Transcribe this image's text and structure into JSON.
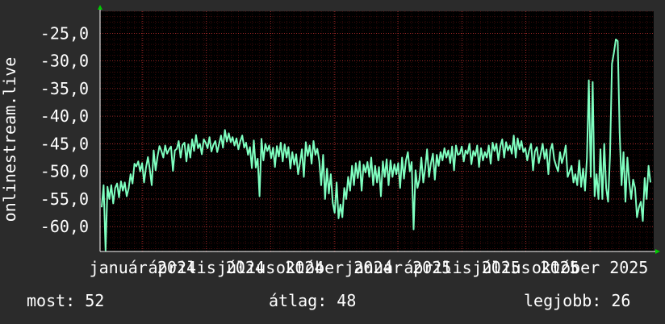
{
  "chart_data": {
    "type": "line",
    "ylabel": "onlinestream.live",
    "ylim": [
      -64.5,
      -21.0
    ],
    "yticks": [
      -25,
      -30,
      -35,
      -40,
      -45,
      -50,
      -55,
      -60
    ],
    "ytick_labels": [
      "-25,0",
      "-30,0",
      "-35,0",
      "-40,0",
      "-45,0",
      "-50,0",
      "-55,0",
      "-60,0"
    ],
    "xlim": [
      0,
      100
    ],
    "xticks": [
      {
        "x": 7.7,
        "label": "január 2024"
      },
      {
        "x": 19.2,
        "label": "április 2024"
      },
      {
        "x": 30.8,
        "label": "július 2024"
      },
      {
        "x": 42.3,
        "label": "október 2024"
      },
      {
        "x": 53.8,
        "label": "január 2025"
      },
      {
        "x": 65.4,
        "label": "április 2025"
      },
      {
        "x": 76.9,
        "label": "július 2025"
      },
      {
        "x": 88.5,
        "label": "október 2025"
      }
    ],
    "grid": true,
    "colors": {
      "background": "#2b2b2b",
      "plot_background": "#000000",
      "grid": "#8b1a1a",
      "axis": "#ffffff",
      "line": "#7fffc0",
      "arrow": "#00cc00"
    },
    "series": [
      {
        "values": [
          -56.5,
          -52.5,
          -64.3,
          -52.8,
          -55.0,
          -52.5,
          -55.8,
          -53.0,
          -52.2,
          -54.7,
          -51.8,
          -53.5,
          -52.0,
          -54.5,
          -53.1,
          -50.5,
          -52.2,
          -48.6,
          -49.1,
          -48.2,
          -50.0,
          -48.5,
          -52.0,
          -49.3,
          -47.4,
          -49.6,
          -52.5,
          -46.2,
          -49.8,
          -47.3,
          -45.4,
          -46.3,
          -47.5,
          -45.3,
          -46.8,
          -46.0,
          -45.5,
          -49.9,
          -46.2,
          -45.9,
          -44.5,
          -47.5,
          -45.2,
          -44.8,
          -48.2,
          -45.1,
          -47.5,
          -44.2,
          -46.3,
          -43.4,
          -45.8,
          -45.0,
          -46.9,
          -44.2,
          -44.8,
          -45.8,
          -43.8,
          -46.4,
          -45.2,
          -44.5,
          -46.5,
          -45.0,
          -43.5,
          -45.7,
          -42.5,
          -44.6,
          -43.1,
          -44.7,
          -43.8,
          -45.3,
          -44.0,
          -46.0,
          -44.5,
          -43.5,
          -45.7,
          -44.8,
          -47.0,
          -45.6,
          -49.4,
          -44.4,
          -49.3,
          -47.7,
          -54.5,
          -44.1,
          -48.0,
          -45.0,
          -46.3,
          -45.3,
          -47.6,
          -45.7,
          -49.2,
          -45.4,
          -47.3,
          -44.8,
          -48.2,
          -45.1,
          -47.5,
          -45.6,
          -49.5,
          -46.5,
          -48.8,
          -46.9,
          -50.5,
          -48.4,
          -46.0,
          -51.0,
          -44.7,
          -47.2,
          -45.3,
          -48.6,
          -44.5,
          -47.0,
          -45.9,
          -48.1,
          -52.5,
          -47.0,
          -55.0,
          -49.5,
          -54.0,
          -50.5,
          -55.7,
          -57.5,
          -52.0,
          -58.5,
          -56.0,
          -58.3,
          -53.0,
          -55.0,
          -51.0,
          -53.5,
          -49.0,
          -52.5,
          -48.5,
          -51.2,
          -48.2,
          -53.5,
          -48.8,
          -50.2,
          -48.3,
          -51.0,
          -47.5,
          -52.5,
          -49.0,
          -52.0,
          -49.2,
          -54.5,
          -48.2,
          -51.0,
          -47.8,
          -52.5,
          -48.0,
          -51.0,
          -48.7,
          -50.5,
          -48.5,
          -53.0,
          -47.5,
          -51.3,
          -48.0,
          -46.5,
          -50.0,
          -48.3,
          -60.5,
          -49.8,
          -53.0,
          -51.5,
          -47.5,
          -52.0,
          -49.5,
          -46.0,
          -51.0,
          -48.5,
          -46.8,
          -51.5,
          -47.0,
          -49.0,
          -46.5,
          -48.0,
          -45.8,
          -47.5,
          -46.2,
          -48.5,
          -45.5,
          -49.8,
          -45.3,
          -47.0,
          -46.8,
          -45.5,
          -48.2,
          -46.2,
          -46.8,
          -45.0,
          -48.7,
          -46.3,
          -47.2,
          -45.3,
          -49.2,
          -45.8,
          -48.0,
          -46.5,
          -47.5,
          -45.3,
          -48.6,
          -44.8,
          -46.3,
          -45.0,
          -48.0,
          -45.5,
          -44.2,
          -47.5,
          -44.7,
          -46.2,
          -45.3,
          -46.8,
          -43.5,
          -47.5,
          -44.0,
          -46.0,
          -44.5,
          -46.5,
          -45.8,
          -48.0,
          -46.2,
          -45.0,
          -49.8,
          -46.4,
          -45.6,
          -48.5,
          -46.8,
          -45.0,
          -47.7,
          -46.0,
          -50.5,
          -46.2,
          -45.0,
          -47.8,
          -49.0,
          -50.0,
          -46.5,
          -48.5,
          -47.2,
          -45.3,
          -51.0,
          -50.0,
          -49.0,
          -52.0,
          -50.5,
          -52.5,
          -48.0,
          -52.8,
          -49.5,
          -53.5,
          -47.5,
          -33.5,
          -51.0,
          -33.8,
          -54.5,
          -50.5,
          -55.0,
          -46.0,
          -55.0,
          -45.0,
          -53.0,
          -55.5,
          -47.0,
          -30.5,
          -28.5,
          -26.1,
          -26.4,
          -43.0,
          -52.5,
          -46.5,
          -55.5,
          -47.5,
          -52.0,
          -55.0,
          -51.5,
          -53.0,
          -58.3,
          -56.5,
          -55.5,
          -59.0,
          -51.2,
          -55.0,
          -49.0,
          -52.0
        ]
      }
    ]
  },
  "stats": {
    "now_label": "most:",
    "now_value": "52",
    "avg_label": "átlag:",
    "avg_value": "48",
    "best_label": "legjobb:",
    "best_value": "26"
  }
}
